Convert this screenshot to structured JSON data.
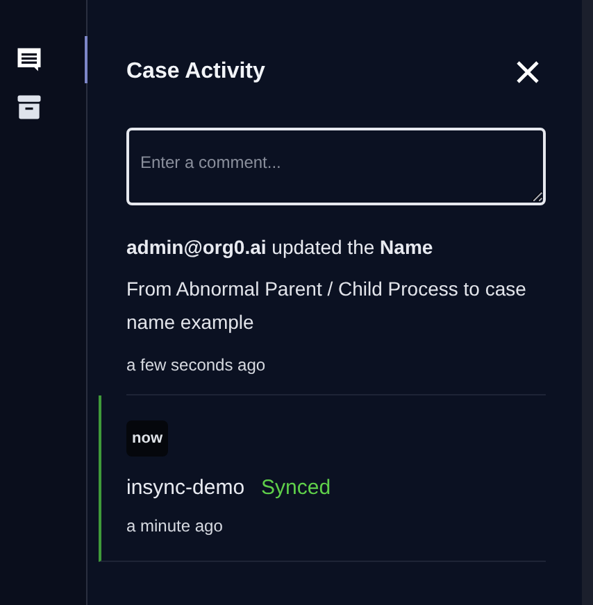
{
  "rail": {
    "items": [
      {
        "kind": "comments",
        "selected": true
      },
      {
        "kind": "archive",
        "selected": false
      }
    ]
  },
  "panel": {
    "title": "Case Activity",
    "comment_box": {
      "placeholder": "Enter a comment..."
    }
  },
  "activities": [
    {
      "kind": "update",
      "heading": "**admin@org0.ai** updated the **Name**",
      "detail": "From Abnormal Parent / Child Process to case name example",
      "time": "a few seconds ago"
    },
    {
      "kind": "sync",
      "logo": "now",
      "source": "insync-demo",
      "status": "Synced",
      "color": "#5fcf4a",
      "time": "a minute ago"
    }
  ]
}
